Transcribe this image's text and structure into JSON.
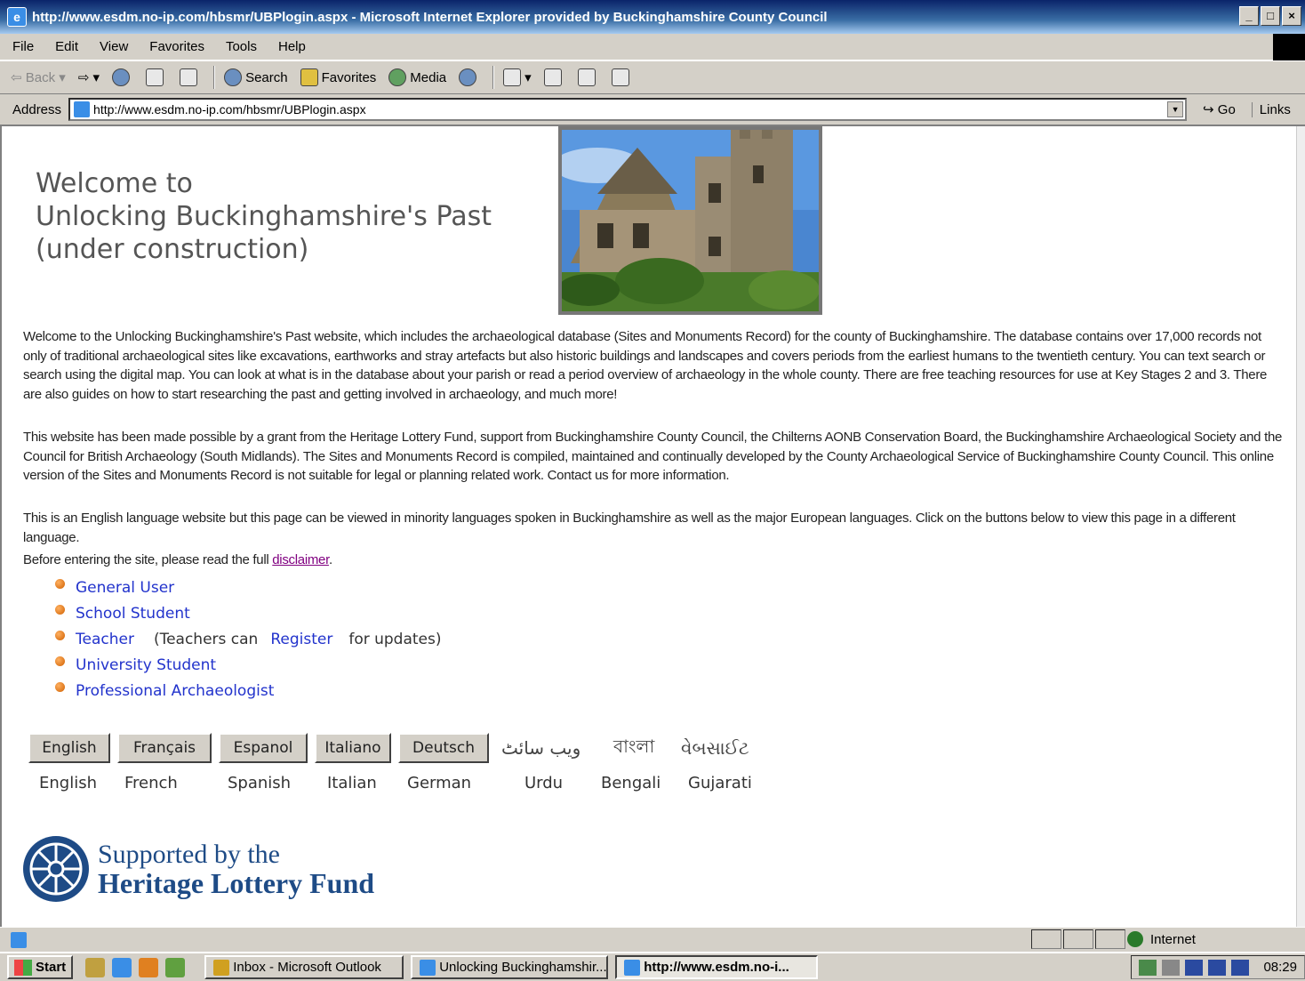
{
  "window": {
    "title": "http://www.esdm.no-ip.com/hbsmr/UBPlogin.aspx - Microsoft Internet Explorer provided by Buckinghamshire County Council",
    "minimize": "_",
    "maximize": "□",
    "close": "×"
  },
  "menu": [
    "File",
    "Edit",
    "View",
    "Favorites",
    "Tools",
    "Help"
  ],
  "toolbar": {
    "back": "Back",
    "search": "Search",
    "favorites": "Favorites",
    "media": "Media"
  },
  "address": {
    "label": "Address",
    "url": "http://www.esdm.no-ip.com/hbsmr/UBPlogin.aspx",
    "go": "Go",
    "links": "Links"
  },
  "page": {
    "welcome_line1": "Welcome to",
    "welcome_line2": "Unlocking Buckinghamshire's Past",
    "welcome_line3": "(under construction)",
    "para1": "Welcome to the Unlocking Buckinghamshire's Past website, which includes the archaeological database (Sites and Monuments Record) for the county of Buckinghamshire. The database contains over 17,000 records not only of traditional archaeological sites like excavations, earthworks and stray artefacts but also historic buildings and landscapes and covers periods from the earliest humans to the twentieth century. You can text search or search using the digital map. You can look at what is in the database about your parish or read a period overview of archaeology in the whole county. There are free teaching resources for use at Key Stages 2 and 3. There are also guides on how to start researching the past and getting involved in archaeology, and much more!",
    "para2": "This website has been made possible by a grant from the Heritage Lottery Fund, support from Buckinghamshire County Council, the Chilterns AONB Conservation Board, the Buckinghamshire Archaeological Society and the Council for British Archaeology (South Midlands). The Sites and Monuments Record is compiled, maintained and continually developed by the County Archaeological Service of Buckinghamshire County Council. This online version of the Sites and Monuments Record is not suitable for legal or planning related work. Contact us for more information.",
    "para3": "This is an English language website but this page can be viewed in minority languages spoken in Buckinghamshire as well as the major European languages. Click on the buttons below to view this page in a different language.",
    "para4_prefix": "Before entering the site, please read the full ",
    "disclaimer_link": "disclaimer",
    "para4_suffix": ".",
    "roles": {
      "general": "General User",
      "school": "School Student",
      "teacher": "Teacher",
      "teacher_note_pre": "(Teachers can",
      "register": "Register",
      "teacher_note_post": "for updates)",
      "university": "University Student",
      "professional": "Professional Archaeologist"
    },
    "languages": {
      "buttons": [
        "English",
        "Français",
        "Espanol",
        "Italiano",
        "Deutsch"
      ],
      "urdu_script": "ویب سائٹ",
      "bengali_script": "বাংলা",
      "gujarati_script": "વેબસાઈટ",
      "names": [
        "English",
        "French",
        "Spanish",
        "Italian",
        "German",
        "Urdu",
        "Bengali",
        "Gujarati"
      ]
    },
    "hlf": {
      "line1": "Supported by the",
      "line2": "Heritage Lottery Fund"
    }
  },
  "status": {
    "zone": "Internet"
  },
  "taskbar": {
    "start": "Start",
    "tasks": [
      "Inbox - Microsoft Outlook",
      "Unlocking Buckinghamshir...",
      "http://www.esdm.no-i..."
    ],
    "clock": "08:29"
  }
}
